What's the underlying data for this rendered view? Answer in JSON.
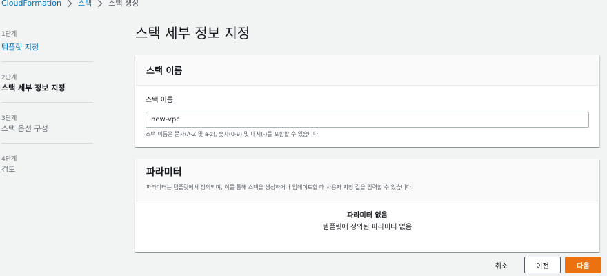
{
  "breadcrumb": {
    "items": [
      "CloudFormation",
      "스택"
    ],
    "current": "스택 생성"
  },
  "steps": [
    {
      "num": "1단계",
      "label": "템플릿 지정",
      "state": "done"
    },
    {
      "num": "2단계",
      "label": "스택 세부 정보 지정",
      "state": "active"
    },
    {
      "num": "3단계",
      "label": "스택 옵션 구성",
      "state": "upcoming"
    },
    {
      "num": "4단계",
      "label": "검토",
      "state": "upcoming"
    }
  ],
  "page_title": "스택 세부 정보 지정",
  "stack_name_panel": {
    "title": "스택 이름",
    "field_label": "스택 이름",
    "value": "new-vpc",
    "hint": "스택 이름은 문자(A-Z 및 a-z), 숫자(0-9) 및 대시(-)를 포함할 수 있습니다."
  },
  "parameters_panel": {
    "title": "파라미터",
    "description": "파라미터는 템플릿에서 정의되며, 이를 통해 스택을 생성하거나 업데이트할 때 사용자 지정 값을 입력할 수 있습니다.",
    "empty_title": "파라미터 없음",
    "empty_text": "템플릿에 정의된 파라미터 없음"
  },
  "buttons": {
    "cancel": "취소",
    "previous": "이전",
    "next": "다음"
  },
  "colors": {
    "link": "#0073bb",
    "primary": "#ec7211",
    "background": "#f2f3f3"
  }
}
